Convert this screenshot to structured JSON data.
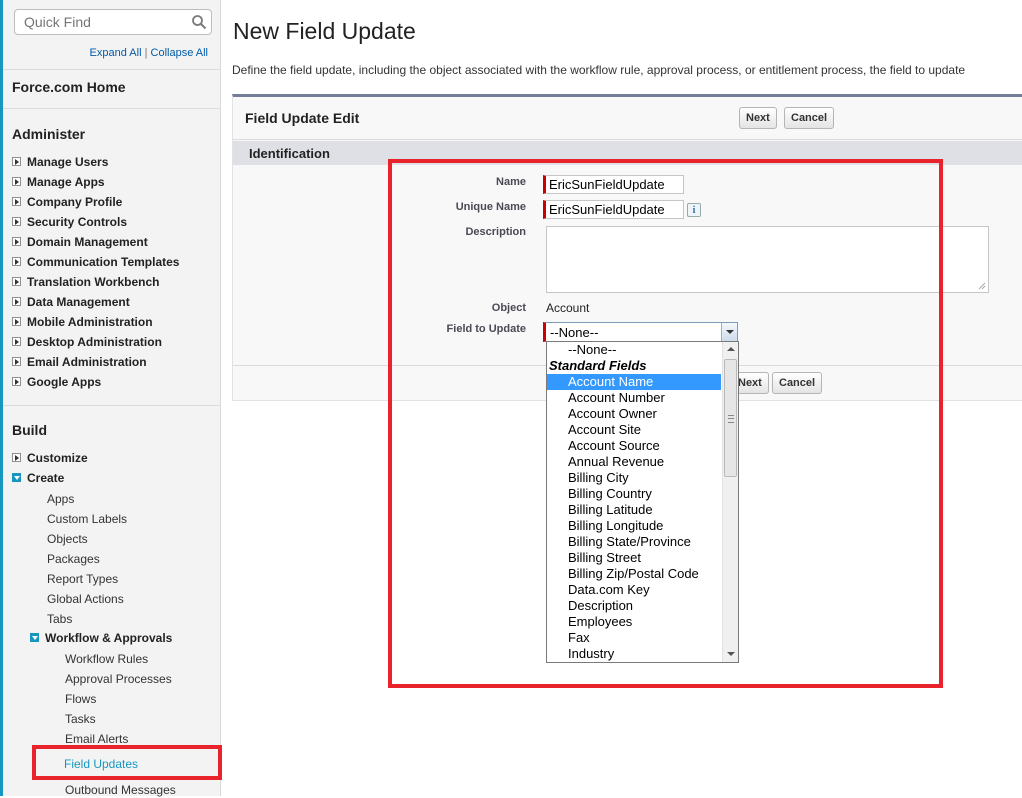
{
  "sidebar": {
    "quick_find_placeholder": "Quick Find",
    "expand_all": "Expand All",
    "separator": "|",
    "collapse_all": "Collapse All",
    "home": "Force.com Home",
    "administer_heading": "Administer",
    "administer_items": [
      "Manage Users",
      "Manage Apps",
      "Company Profile",
      "Security Controls",
      "Domain Management",
      "Communication Templates",
      "Translation Workbench",
      "Data Management",
      "Mobile Administration",
      "Desktop Administration",
      "Email Administration",
      "Google Apps"
    ],
    "build_heading": "Build",
    "customize": "Customize",
    "create": "Create",
    "create_items": [
      "Apps",
      "Custom Labels",
      "Objects",
      "Packages",
      "Report Types",
      "Global Actions",
      "Tabs"
    ],
    "workflow": "Workflow & Approvals",
    "workflow_items": [
      "Workflow Rules",
      "Approval Processes",
      "Flows",
      "Tasks",
      "Email Alerts",
      "Field Updates",
      "Outbound Messages"
    ]
  },
  "main": {
    "title": "New Field Update",
    "description": "Define the field update, including the object associated with the workflow rule, approval process, or entitlement process, the field to update",
    "panel_title": "Field Update Edit",
    "next_label": "Next",
    "cancel_label": "Cancel",
    "footer_next_label": "Next",
    "section_title": "Identification",
    "fields": {
      "name_label": "Name",
      "name_value": "EricSunFieldUpdate",
      "unique_label": "Unique Name",
      "unique_value": "EricSunFieldUpdate",
      "info_glyph": "i",
      "description_label": "Description",
      "object_label": "Object",
      "object_value": "Account",
      "field_label": "Field to Update",
      "field_value": "--None--"
    },
    "dropdown": {
      "none_option": "--None--",
      "group_label": "Standard Fields",
      "options": [
        "Account Name",
        "Account Number",
        "Account Owner",
        "Account Site",
        "Account Source",
        "Annual Revenue",
        "Billing City",
        "Billing Country",
        "Billing Latitude",
        "Billing Longitude",
        "Billing State/Province",
        "Billing Street",
        "Billing Zip/Postal Code",
        "Data.com Key",
        "Description",
        "Employees",
        "Fax",
        "Industry"
      ],
      "selected_index": 0
    }
  },
  "colors": {
    "accent": "#1797c0",
    "highlight": "#e8232b",
    "required": "#cc0000",
    "selection": "#3399ff"
  },
  "icons": {
    "quick_find": "search-icon",
    "info": "info-icon",
    "expand": "toggle-closed-icon",
    "collapse": "toggle-open-icon"
  }
}
